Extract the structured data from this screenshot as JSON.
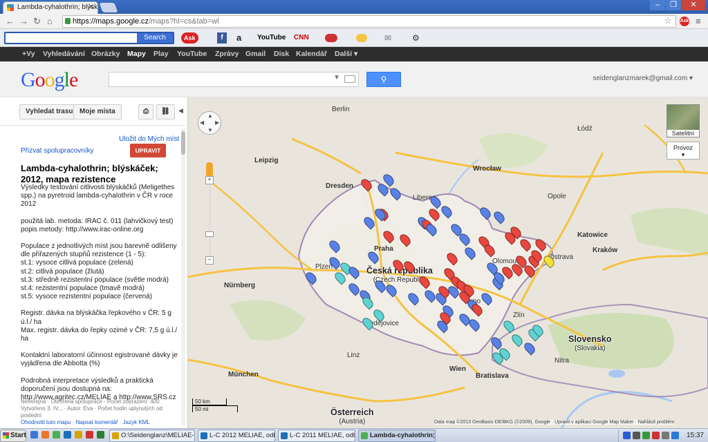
{
  "browser": {
    "tabs": [
      {
        "title": "Lambda-cyhalothrin; blýskáč"
      },
      {
        "title": ""
      }
    ],
    "url_host": "https://maps.google.cz",
    "url_rest": "/maps?hl=cs&tab=wl"
  },
  "toolbar": {
    "search_button": "Search",
    "items": [
      "Ask",
      "f",
      "a",
      "YouTube",
      "CNN",
      "Weather",
      "Mail",
      "Dragon"
    ]
  },
  "gbar": {
    "items": [
      "+Vy",
      "Vyhledávání",
      "Obrázky",
      "Mapy",
      "Play",
      "YouTube",
      "Zprávy",
      "Gmail",
      "Disk",
      "Kalendář",
      "Další"
    ],
    "active": "Mapy"
  },
  "header": {
    "logo": "Google",
    "search_value": "",
    "account": "seidenglanzmarek@gmail.com"
  },
  "sidebar": {
    "route_button": "Vyhledat trasu",
    "myplaces_button": "Moje místa",
    "save_link": "Uložit do Mých míst",
    "collab_link": "Přizvat spolupracovníky",
    "edit_button": "UPRAVIT",
    "title": "Lambda-cyhalothrin; blýskáček; 2012, mapa rezistence",
    "paragraphs": [
      "Výsledky testování citlivosti blýskáčků (Meligethes spp.) na pyretroid lambda-cyhalothrin v ČR v roce 2012",
      "použitá lab. metoda: IRAC č. 011 (lahvičkový test)\npopis metody: http://www.irac-online.org",
      "Populace z jednotlivých míst jsou barevně odlišeny dle přiřazených stupňů rezistence (1 - 5):\nst.1: vysoce citlivá populace (zelená)\nst.2: citlivá populace (žlutá)\nst.3: středně rezistentní populace (světle modrá)\nst.4: rezistentní populace (tmavě modrá)\nst.5: vysoce rezistentní populace (červená)",
      "Registr. dávka na blýskáčka řepkového v ČR: 5 g ú.l./ ha\nMax. registr. dávka do řepky ozimé v ČR: 7,5 g ú.l./ ha",
      "",
      "Kontaktní laboratorní účinnost egistrované dávky je vyjádřena dle Abbotta (%)",
      "Podrobná interpretace výsledků a praktická doporučení jsou dostupná na:\nhttp://www.agritec.cz/MELIAE a http://www.SRS.cz"
    ],
    "meta_line1": "Neveřejná · Otevřená spolupráce · Počet zobrazení: 400",
    "meta_line2": "Vytvořeno 3. IV... · Autor: Eva · Počet hodin uplynulých od poslední",
    "meta_links": [
      "Ohodnotit tuto mapu",
      "Napsat komentář",
      "Jazyk KML"
    ]
  },
  "map": {
    "satellite_label": "Satelitní",
    "traffic_label": "Provoz",
    "scale_km": "50 km",
    "scale_mi": "50 mi",
    "attribution": "Data map ©2013 GeoBasis-DE/BKG (©2009), Google · Upravit v aplikaci Google Map Maker · Nahlásit problém",
    "countries": [
      {
        "name": "Česká republika",
        "sub": "(Czech Republic)"
      },
      {
        "name": "Slovensko",
        "sub": "(Slovakia)"
      },
      {
        "name": "Österreich",
        "sub": "(Austria)"
      }
    ],
    "cities": [
      "Łódź",
      "Wrocław",
      "Leipzig",
      "Dresden",
      "Praha",
      "Katowice",
      "Kraków",
      "Plzeň",
      "Nürnberg",
      "München",
      "Wien",
      "Bratislava",
      "Brno",
      "Ostrava",
      "Liberec",
      "Zlín",
      "Nitra",
      "Budějovice",
      "Linz",
      "Olomouc",
      "Opole",
      "Berlin"
    ],
    "legend_colors": {
      "blue": "#5a82e6",
      "red": "#e8483f",
      "cyan": "#5fd2d2",
      "yellow": "#f2e23a"
    }
  },
  "taskbar": {
    "start": "Start",
    "tasks": [
      "O:\\Seidenglanz\\MELIAE-...",
      "L-C 2012 MELIAE, odb. ...",
      "L-C 2011 MELIAE, odb. ...",
      "Lambda-cyhalothrin; ..."
    ],
    "clock": "15:37"
  }
}
